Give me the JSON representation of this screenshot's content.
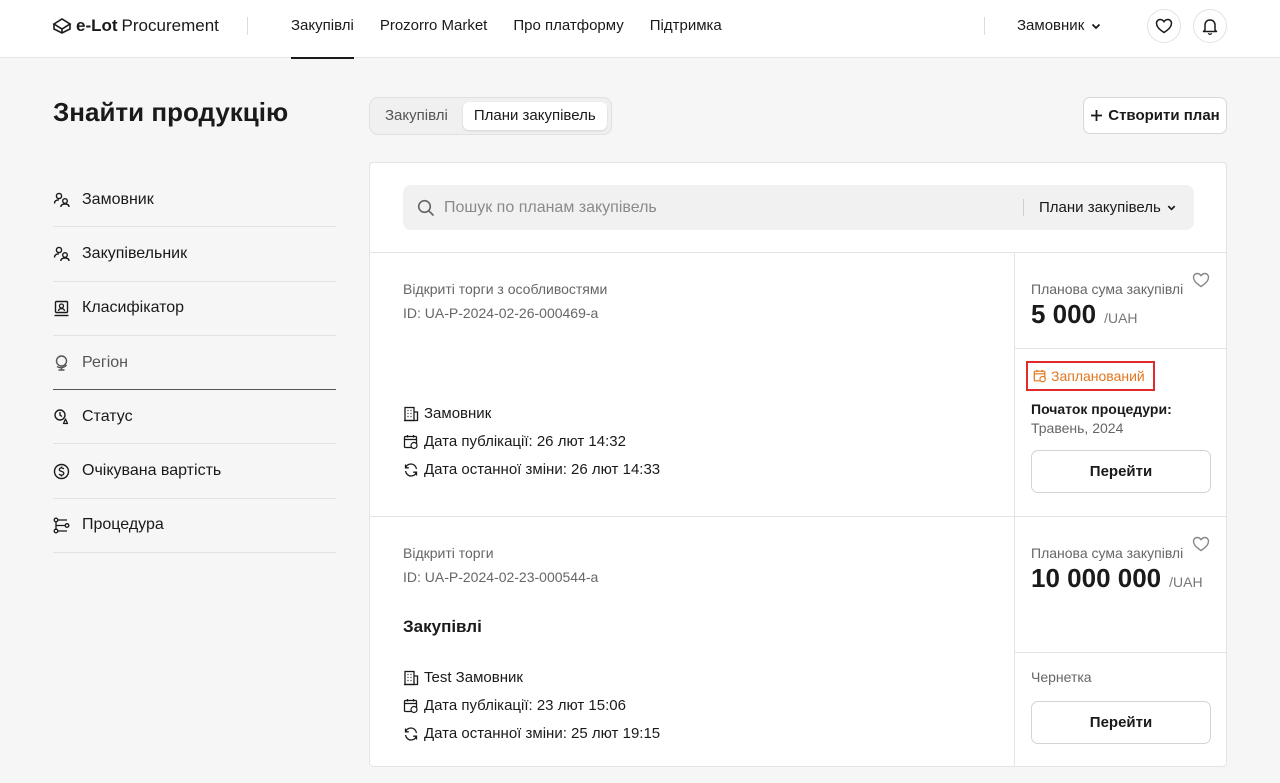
{
  "header": {
    "logo_brand": "e-Lot",
    "logo_name": "Procurement",
    "nav": [
      "Закупівлі",
      "Prozorro Market",
      "Про платформу",
      "Підтримка"
    ],
    "role": "Замовник"
  },
  "page": {
    "title": "Знайти продукцію",
    "tabs": [
      "Закупівлі",
      "Плани закупівель"
    ],
    "create_button": "Створити план"
  },
  "filters": [
    {
      "label": "Замовник",
      "icon": "users-icon"
    },
    {
      "label": "Закупівельник",
      "icon": "users-icon"
    },
    {
      "label": "Класифікатор",
      "icon": "classifier-icon"
    },
    {
      "label": "Регіон",
      "icon": "globe-icon"
    },
    {
      "label": "Статус",
      "icon": "status-icon"
    },
    {
      "label": "Очікувана вартість",
      "icon": "coin-icon"
    },
    {
      "label": "Процедура",
      "icon": "procedure-icon"
    }
  ],
  "search": {
    "placeholder": "Пошук по планам закупівель",
    "scope": "Плани закупівель"
  },
  "cards": [
    {
      "type": "Відкриті торги з особливостями",
      "id": "ID: UA-P-2024-02-26-000469-a",
      "title": "",
      "customer": "Замовник",
      "published": "Дата публікації: 26 лют 14:32",
      "modified": "Дата останної зміни: 26 лют 14:33",
      "amount_label": "Планова сума закупівлі",
      "amount": "5 000",
      "currency": "/UAH",
      "status": "Запланований",
      "start_label": "Початок процедури:",
      "start_value": "Травень, 2024",
      "button": "Перейти"
    },
    {
      "type": "Відкриті торги",
      "id": "ID: UA-P-2024-02-23-000544-a",
      "title": "Закупівлі",
      "customer": "Test Замовник",
      "published": "Дата публікації: 23 лют 15:06",
      "modified": "Дата останної зміни: 25 лют 19:15",
      "amount_label": "Планова сума закупівлі",
      "amount": "10 000 000",
      "currency": "/UAH",
      "status": "Чернетка",
      "button": "Перейти"
    }
  ],
  "colors": {
    "accent_status": "#e3771f",
    "highlight_border": "#e02b2b"
  }
}
